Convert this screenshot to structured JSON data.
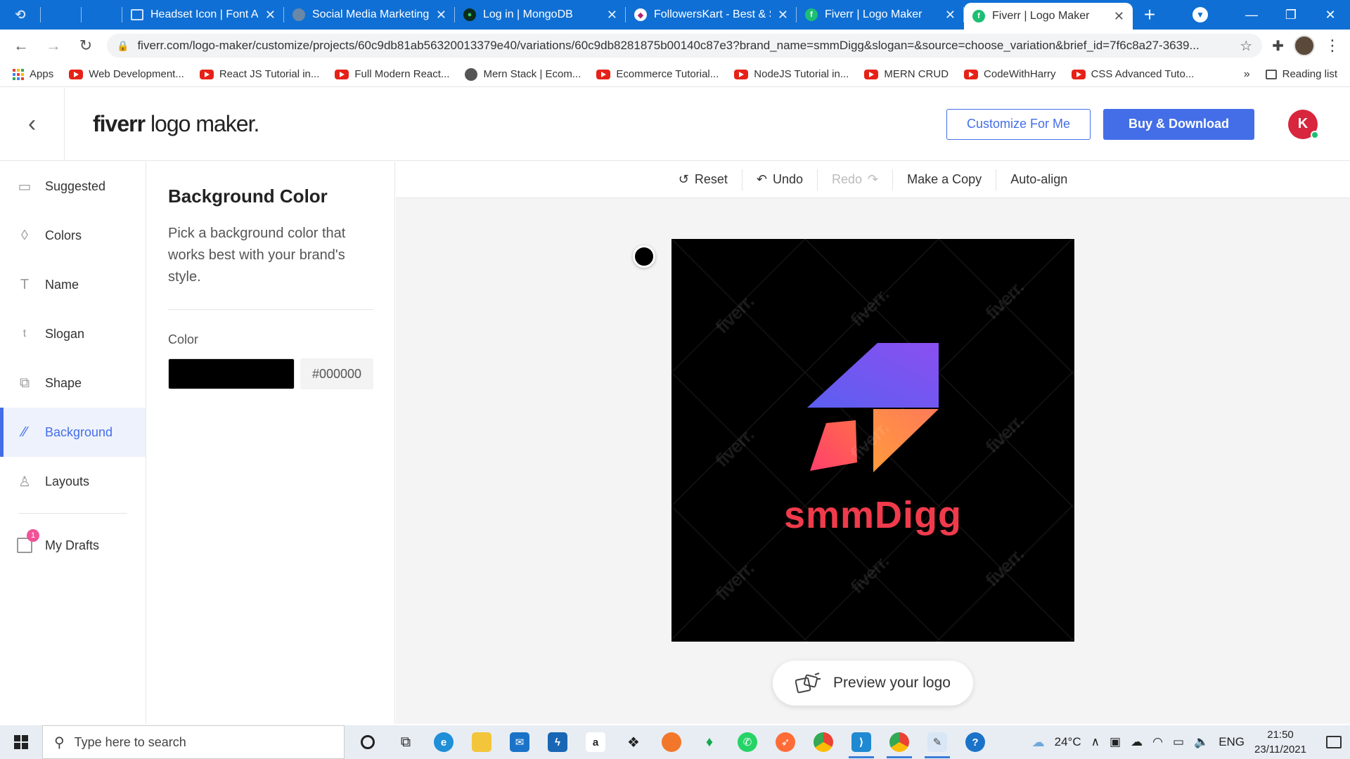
{
  "browser": {
    "tabs": [
      {
        "label": "",
        "icon": "edge-swirl-icon"
      },
      {
        "label": "",
        "icon": "blank-icon"
      },
      {
        "label": "",
        "icon": "blank-icon"
      },
      {
        "label": "Headset Icon | Font Awe",
        "icon": "flag-icon"
      },
      {
        "label": "Social Media Marketing",
        "icon": "globe-icon"
      },
      {
        "label": "Log in | MongoDB",
        "icon": "mongodb-leaf-icon"
      },
      {
        "label": "FollowersKart - Best & S",
        "icon": "followerskart-icon"
      },
      {
        "label": "Fiverr | Logo Maker",
        "icon": "fiverr-icon"
      },
      {
        "label": "Fiverr | Logo Maker",
        "icon": "fiverr-icon",
        "active": true
      }
    ],
    "url": "fiverr.com/logo-maker/customize/projects/60c9db81ab56320013379e40/variations/60c9db8281875b00140c87e3?brand_name=smmDigg&slogan=&source=choose_variation&brief_id=7f6c8a27-3639...",
    "bookmarks": [
      {
        "label": "Apps",
        "icon": "apps-grid-icon"
      },
      {
        "label": "Web Development...",
        "icon": "youtube-icon"
      },
      {
        "label": "React JS Tutorial in...",
        "icon": "youtube-icon"
      },
      {
        "label": "Full Modern React...",
        "icon": "youtube-icon"
      },
      {
        "label": "Mern Stack | Ecom...",
        "icon": "globe-icon"
      },
      {
        "label": "Ecommerce Tutorial...",
        "icon": "youtube-icon"
      },
      {
        "label": "NodeJS Tutorial in...",
        "icon": "youtube-icon"
      },
      {
        "label": "MERN CRUD",
        "icon": "youtube-icon"
      },
      {
        "label": "CodeWithHarry",
        "icon": "youtube-icon"
      },
      {
        "label": "CSS Advanced Tuto...",
        "icon": "youtube-icon"
      }
    ],
    "bookmarks_more": "»",
    "reading_list": "Reading list"
  },
  "header": {
    "logo_bold": "fiverr",
    "logo_rest": " logo maker.",
    "customize_label": "Customize For Me",
    "buy_label": "Buy & Download",
    "avatar_letter": "K"
  },
  "sidebar": {
    "items": [
      {
        "label": "Suggested",
        "icon": "suggested-icon"
      },
      {
        "label": "Colors",
        "icon": "droplet-icon"
      },
      {
        "label": "Name",
        "icon": "text-t-icon"
      },
      {
        "label": "Slogan",
        "icon": "text-small-t-icon"
      },
      {
        "label": "Shape",
        "icon": "shape-icon"
      },
      {
        "label": "Background",
        "icon": "background-icon",
        "active": true
      },
      {
        "label": "Layouts",
        "icon": "layout-icon"
      }
    ],
    "drafts_label": "My Drafts",
    "drafts_count": "1"
  },
  "panel": {
    "title": "Background Color",
    "description": "Pick a background color that works best with your brand's style.",
    "color_label": "Color",
    "color_value": "#000000"
  },
  "toolbar": {
    "reset": "Reset",
    "undo": "Undo",
    "redo": "Redo",
    "copy": "Make a Copy",
    "autoalign": "Auto-align"
  },
  "logo": {
    "brand_name": "smmDigg",
    "background": "#000000",
    "brand_color": "#ef3b4c",
    "watermark": "fiverr."
  },
  "preview": {
    "label": "Preview your logo"
  },
  "taskbar": {
    "search_placeholder": "Type here to search",
    "temperature": "24°C",
    "language": "ENG",
    "time": "21:50",
    "date": "23/11/2021"
  }
}
